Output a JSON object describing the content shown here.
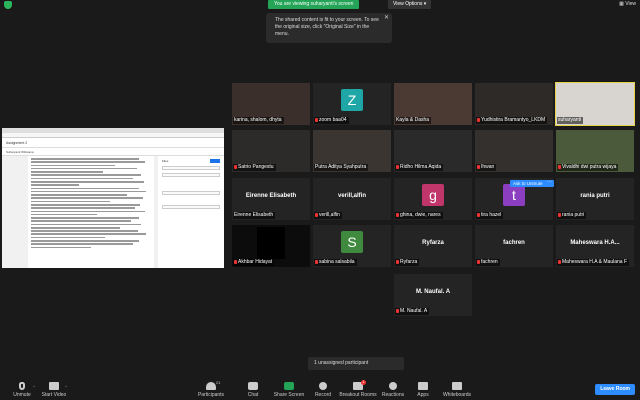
{
  "banner": {
    "viewing_text": "You are viewing suharyanti's screen",
    "view_options": "View Options",
    "view_label": "View"
  },
  "tooltip": {
    "text": "The shared content is fit to your screen. To see the original size, click \"Original Size\" in the menu."
  },
  "shared_screen": {
    "doc_title": "Assignment 2",
    "doc_owner": "Suharyanti Wibisana",
    "panel_title": "Files",
    "panel_submit": "Submit"
  },
  "participants": [
    {
      "label": "karina, shalom, dhyta",
      "type": "video",
      "muted": false
    },
    {
      "label": "zoom baa04",
      "type": "avatar",
      "letter": "Z",
      "color": "#1fa7a7",
      "muted": true
    },
    {
      "label": "Kayla & Dasha",
      "type": "video",
      "muted": false
    },
    {
      "label": "Yudhistira Bramantyo_LKDM",
      "type": "video",
      "muted": true
    },
    {
      "label": "suharyanti",
      "type": "video",
      "muted": false,
      "active": true
    },
    {
      "label": "Satrio Pangestu",
      "type": "video",
      "muted": true
    },
    {
      "label": "Putra Aditya Syahputra",
      "type": "video",
      "muted": false
    },
    {
      "label": "Ridho Hilma Aqida",
      "type": "video",
      "muted": true
    },
    {
      "label": "Ihwan",
      "type": "video",
      "muted": true
    },
    {
      "label": "Vivaldhi dwi putra wijaya",
      "type": "video",
      "muted": true
    },
    {
      "label": "Eirenne Elisabeth",
      "type": "name",
      "display": "Eirenne Elisabeth",
      "muted": false
    },
    {
      "label": "verill,alfin",
      "type": "name",
      "display": "verill,alfin",
      "muted": true
    },
    {
      "label": "ghina, dwie, nares",
      "type": "avatar",
      "letter": "g",
      "color": "#c0356a",
      "muted": true
    },
    {
      "label": "tira hazel",
      "type": "avatar",
      "letter": "t",
      "color": "#8b3fc0",
      "muted": true
    },
    {
      "label": "rania putri",
      "type": "name",
      "display": "rania putri",
      "muted": true
    },
    {
      "label": "Akhbar Hidayat",
      "type": "video",
      "muted": true
    },
    {
      "label": "sabina salsabila",
      "type": "avatar",
      "letter": "S",
      "color": "#3f8a3f",
      "muted": true
    },
    {
      "label": "Ryfarza",
      "type": "name",
      "display": "Ryfarza",
      "muted": true
    },
    {
      "label": "fachren",
      "type": "name",
      "display": "fachren",
      "muted": true
    },
    {
      "label": "Maheswara H.A & Maulana F",
      "type": "name",
      "display": "Maheswara H.A...",
      "muted": true
    },
    {
      "label": "M. Naufal. A",
      "type": "name",
      "display": "M. Naufal. A",
      "muted": true
    }
  ],
  "ask_to_unmute": "Ask to Unmute",
  "more_label": "···",
  "unassigned": "1 unassigned participant",
  "toolbar": {
    "unmute": "Unmute",
    "start_video": "Start Video",
    "participants": "Participants",
    "participants_count": "21",
    "chat": "Chat",
    "share_screen": "Share Screen",
    "record": "Record",
    "breakout_rooms": "Breakout Rooms",
    "breakout_badge": "1",
    "reactions": "Reactions",
    "apps": "Apps",
    "whiteboards": "Whiteboards",
    "leave": "Leave Room"
  },
  "colors": {
    "accent": "#2d8cff",
    "share_green": "#23a456",
    "active_speaker": "#e8d24a",
    "background": "#1a1a1a",
    "tile": "#242424"
  }
}
